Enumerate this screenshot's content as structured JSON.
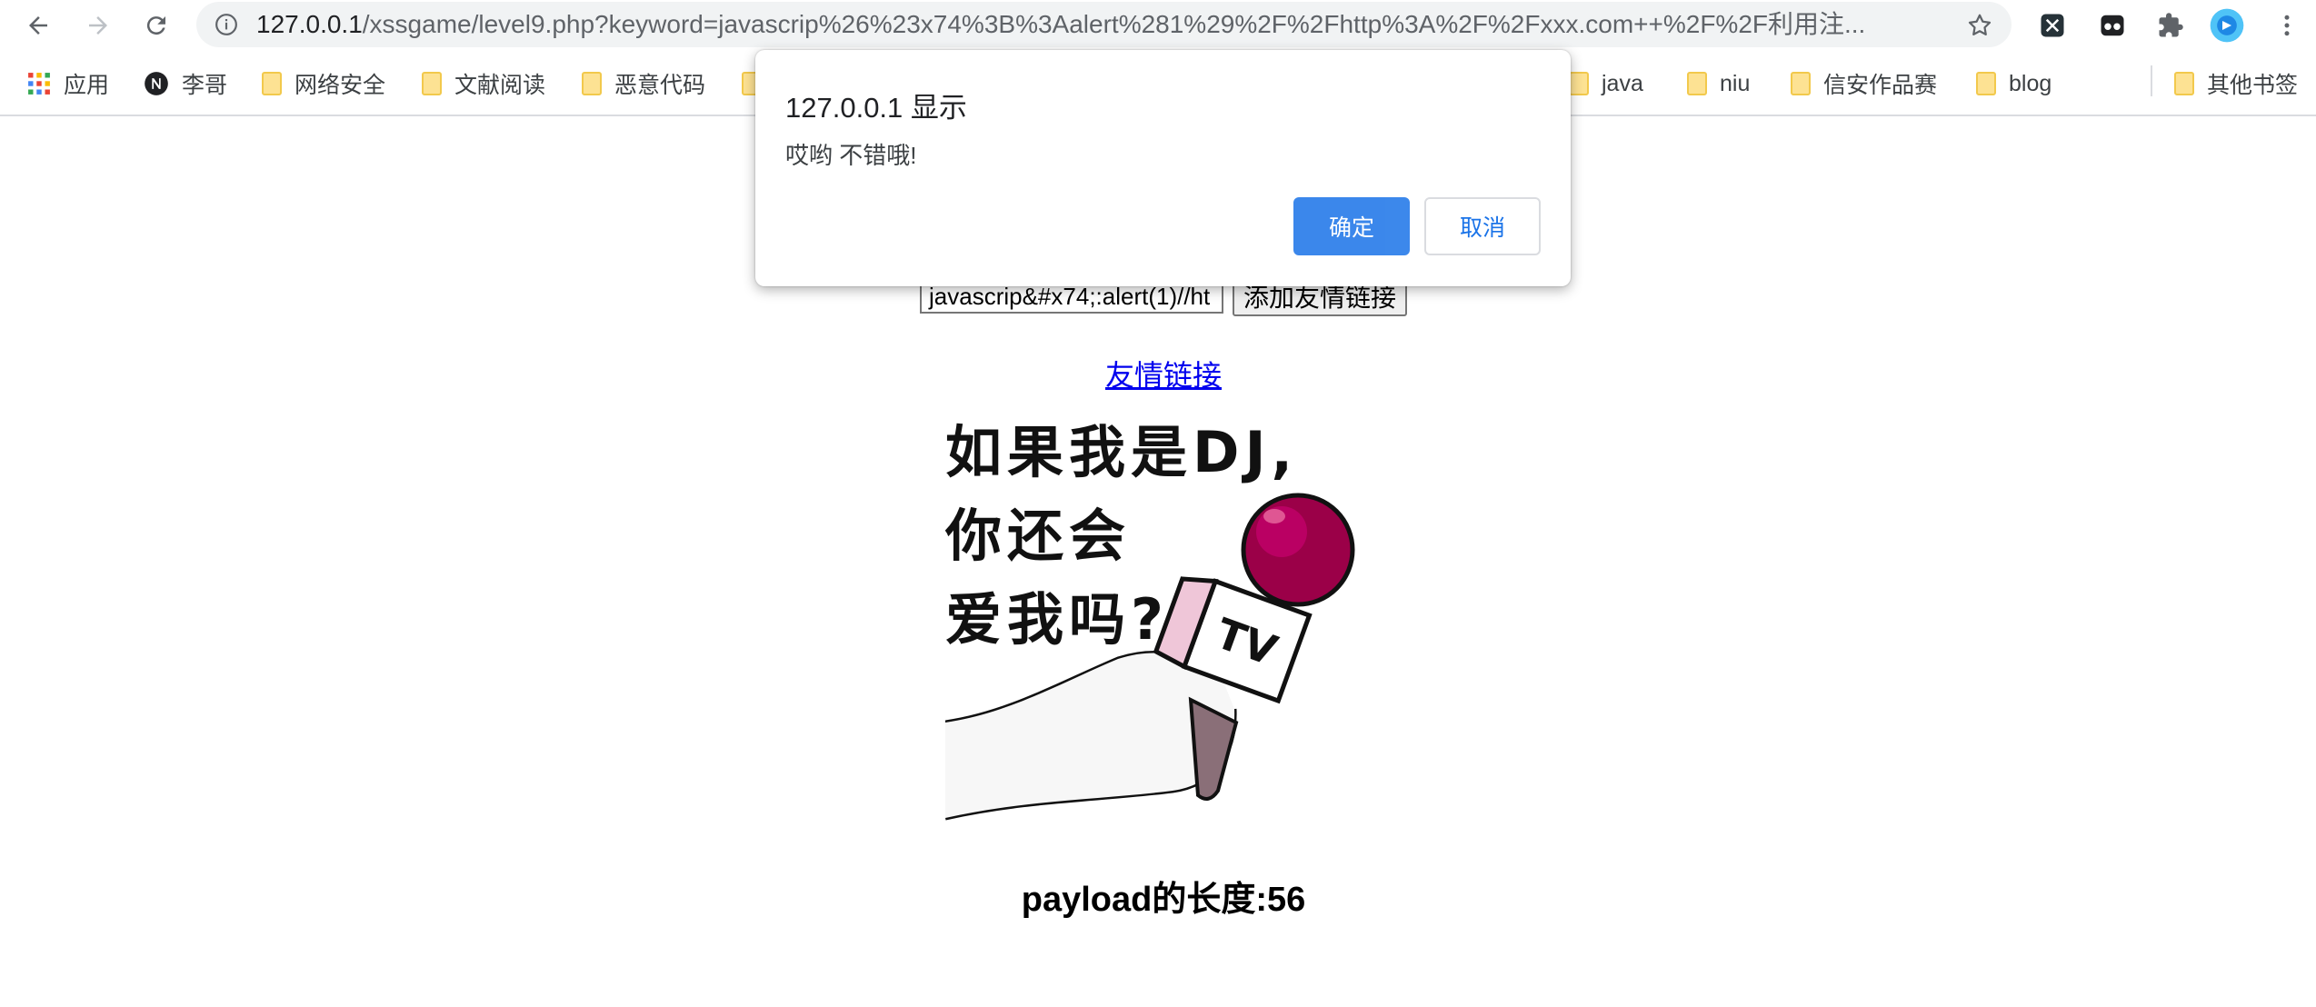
{
  "browser": {
    "url_host": "127.0.0.1",
    "url_rest": "/xssgame/level9.php?keyword=javascrip%26%23x74%3B%3Aalert%281%29%2F%2Fhttp%3A%2F%2Fxxx.com++%2F%2F利用注..."
  },
  "bookmarks": {
    "apps": "应用",
    "items": [
      "李哥",
      "网络安全",
      "文献阅读",
      "恶意代码",
      "java",
      "niu",
      "信安作品赛",
      "blog"
    ],
    "other": "其他书签"
  },
  "page": {
    "input_value": "javascrip&#x74;:alert(1)//ht",
    "add_button": "添加友情链接",
    "link_text": "友情链接",
    "meme_line1": "如果我是DJ,",
    "meme_line2": "你还会",
    "meme_line3": "爱我吗?",
    "meme_tv": "TV",
    "payload_text": "payload的长度:56"
  },
  "dialog": {
    "title": "127.0.0.1 显示",
    "message": "哎哟 不错哦!",
    "ok_label": "确定",
    "cancel_label": "取消"
  },
  "colors": {
    "accent": "#1a73e8",
    "link": "#0000ee",
    "folder": "#fde293"
  },
  "icons": {
    "back": "arrow-left-icon",
    "forward": "arrow-right-icon",
    "reload": "reload-icon",
    "info": "info-icon",
    "star": "star-icon",
    "extensions": "puzzle-icon",
    "menu": "kebab-menu-icon"
  }
}
